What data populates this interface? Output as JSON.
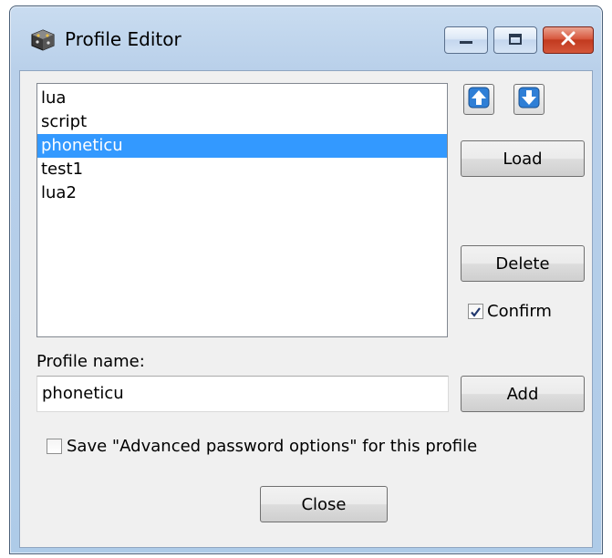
{
  "window": {
    "title": "Profile Editor"
  },
  "profiles": {
    "items": [
      "lua",
      "script",
      "phoneticu",
      "test1",
      "lua2"
    ],
    "selected": "phoneticu"
  },
  "buttons": {
    "load": "Load",
    "delete": "Delete",
    "add": "Add",
    "close": "Close"
  },
  "confirm": {
    "label": "Confirm",
    "checked": true
  },
  "profile_name": {
    "label": "Profile name:",
    "value": "phoneticu"
  },
  "save_advanced": {
    "label": "Save \"Advanced password options\" for this profile",
    "checked": false
  },
  "colors": {
    "selection": "#3399ff",
    "arrow_blue": "#2f7fd6"
  }
}
